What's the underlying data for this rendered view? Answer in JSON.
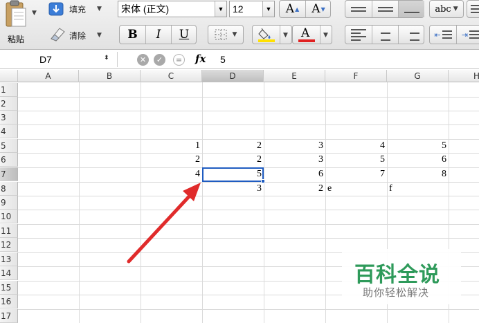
{
  "toolbar": {
    "paste_label": "粘贴",
    "fill_label": "填充",
    "clear_label": "清除",
    "font_name": "宋体 (正文)",
    "font_size": "12",
    "grow_font_glyph": "A",
    "shrink_font_glyph": "A",
    "bold_glyph": "B",
    "italic_glyph": "I",
    "underline_glyph": "U",
    "font_color_glyph": "A",
    "wrap_text_label": "abc",
    "fill_color": "#ffe000",
    "font_color": "#e02020"
  },
  "formula_bar": {
    "name_box": "D7",
    "fx_label": "fx",
    "value": "5"
  },
  "sheet": {
    "columns": [
      "A",
      "B",
      "C",
      "D",
      "E",
      "F",
      "G",
      "H"
    ],
    "rows": [
      "1",
      "2",
      "3",
      "4",
      "5",
      "6",
      "7",
      "8",
      "9",
      "10",
      "11",
      "12",
      "13",
      "14",
      "15",
      "16",
      "17"
    ],
    "selected_cell": "D7",
    "cells": {
      "C5": "1",
      "D5": "2",
      "E5": "3",
      "F5": "4",
      "G5": "5",
      "C6": "2",
      "D6": "2",
      "E6": "3",
      "F6": "5",
      "G6": "6",
      "C7": "4",
      "D7": "5",
      "E7": "6",
      "F7": "7",
      "G7": "8",
      "D8": "3",
      "E8": "2",
      "F8": "e",
      "G8": "f"
    },
    "selection_color": "#1f5cc1"
  },
  "annotation": {
    "arrow_color": "#e02b2b"
  },
  "watermark": {
    "title": "百科全说",
    "subtitle": "助你轻松解决"
  }
}
